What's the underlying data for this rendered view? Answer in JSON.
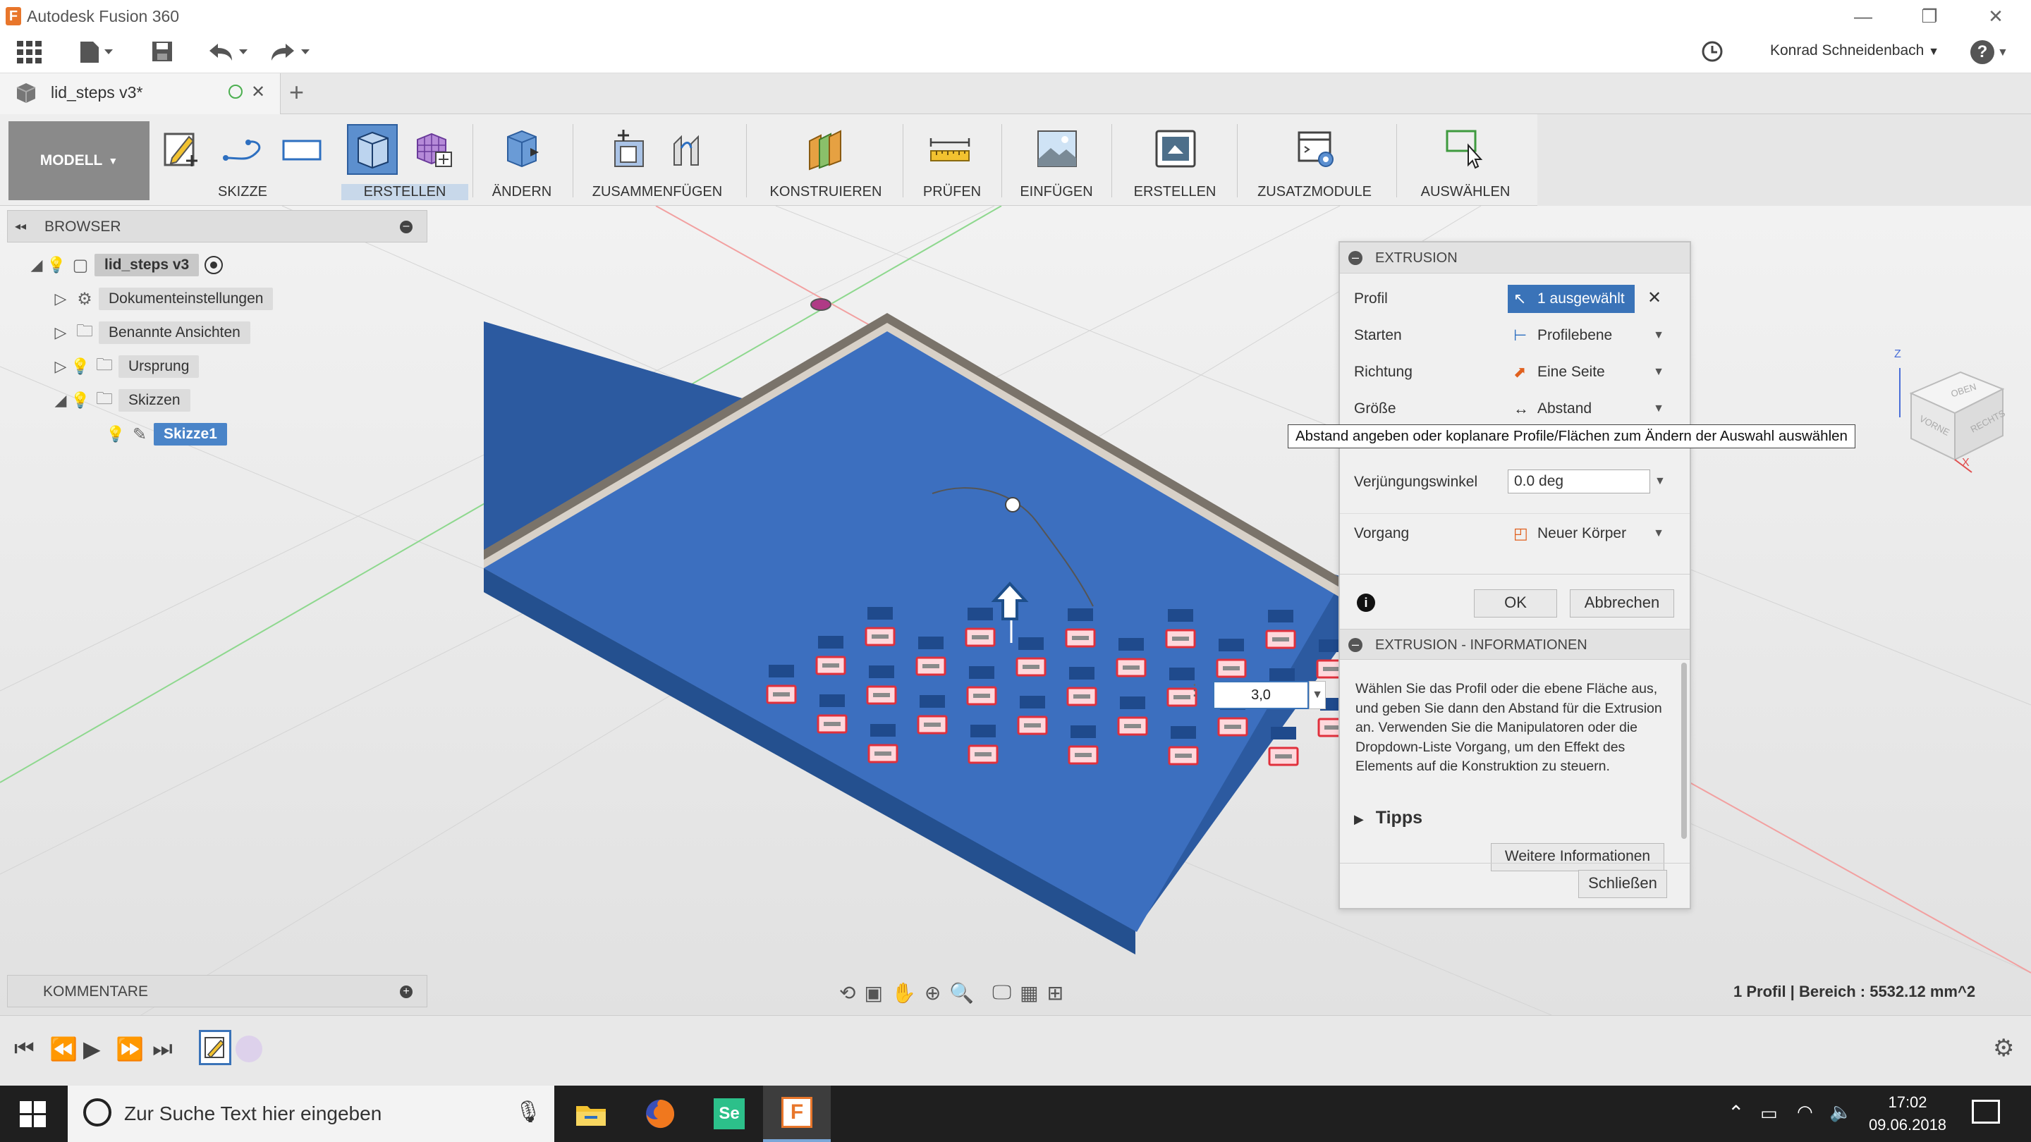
{
  "window": {
    "app_title": "Autodesk Fusion 360",
    "app_logo": "F",
    "minimize_glyph": "—",
    "restore_glyph": "❐",
    "close_glyph": "✕"
  },
  "app_toolbar": {
    "user_name": "Konrad Schneidenbach",
    "dropdown_glyph": "▼",
    "help_glyph": "?"
  },
  "tabs": {
    "doc_name": "lid_steps v3*",
    "close_glyph": "✕",
    "new_tab_glyph": "+"
  },
  "ribbon": {
    "workspace": "MODELL",
    "groups": [
      {
        "label": "SKIZZE"
      },
      {
        "label": "ERSTELLEN"
      },
      {
        "label": "ÄNDERN"
      },
      {
        "label": "ZUSAMMENFÜGEN"
      },
      {
        "label": "KONSTRUIEREN"
      },
      {
        "label": "PRÜFEN"
      },
      {
        "label": "EINFÜGEN"
      },
      {
        "label": "ERSTELLEN"
      },
      {
        "label": "ZUSATZMODULE"
      },
      {
        "label": "AUSWÄHLEN"
      }
    ]
  },
  "browser": {
    "title": "BROWSER",
    "collapse_glyph": "◂◂",
    "items": [
      {
        "label": "lid_steps v3"
      },
      {
        "label": "Dokumenteinstellungen"
      },
      {
        "label": "Benannte Ansichten"
      },
      {
        "label": "Ursprung"
      },
      {
        "label": "Skizzen"
      },
      {
        "label": "Skizze1"
      }
    ]
  },
  "comments": {
    "title": "KOMMENTARE"
  },
  "extrude_dialog": {
    "title": "EXTRUSION",
    "rows": [
      {
        "key": "Profil",
        "value": "1 ausgewählt"
      },
      {
        "key": "Starten",
        "value": "Profilebene"
      },
      {
        "key": "Richtung",
        "value": "Eine Seite"
      },
      {
        "key": "Größe",
        "value": "Abstand"
      },
      {
        "key": "Verjüngungswinkel",
        "value": "0.0 deg"
      },
      {
        "key": "Vorgang",
        "value": "Neuer Körper"
      }
    ],
    "ok_label": "OK",
    "cancel_label": "Abbrechen",
    "info_title": "EXTRUSION - INFORMATIONEN",
    "info_text": "Wählen Sie das Profil oder die ebene Fläche aus, und geben Sie dann den Abstand für die Extrusion an. Verwenden Sie die Manipulatoren oder die Dropdown-Liste Vorgang, um den Effekt des Elements auf die Konstruktion zu steuern.",
    "tips_label": "Tipps",
    "more_info_label": "Weitere Informationen",
    "close_label": "Schließen"
  },
  "tooltip": "Abstand angeben oder koplanare Profile/Flächen zum Ändern der Auswahl auswählen",
  "dimension_input": "3,0",
  "status_text": "1 Profil | Bereich : 5532.12 mm^2",
  "viewcube": {
    "top": "OBEN",
    "front": "VORNE",
    "right": "RECHTS",
    "axis_x": "X",
    "axis_z": "Z"
  },
  "taskbar": {
    "search_placeholder": "Zur Suche Text hier eingeben",
    "time": "17:02",
    "date": "09.06.2018",
    "se_app": "Se",
    "fusion_app": "F"
  },
  "colors": {
    "accent": "#3a73b8",
    "plate": "#3c6fbf",
    "fusion_orange": "#e8762b"
  }
}
